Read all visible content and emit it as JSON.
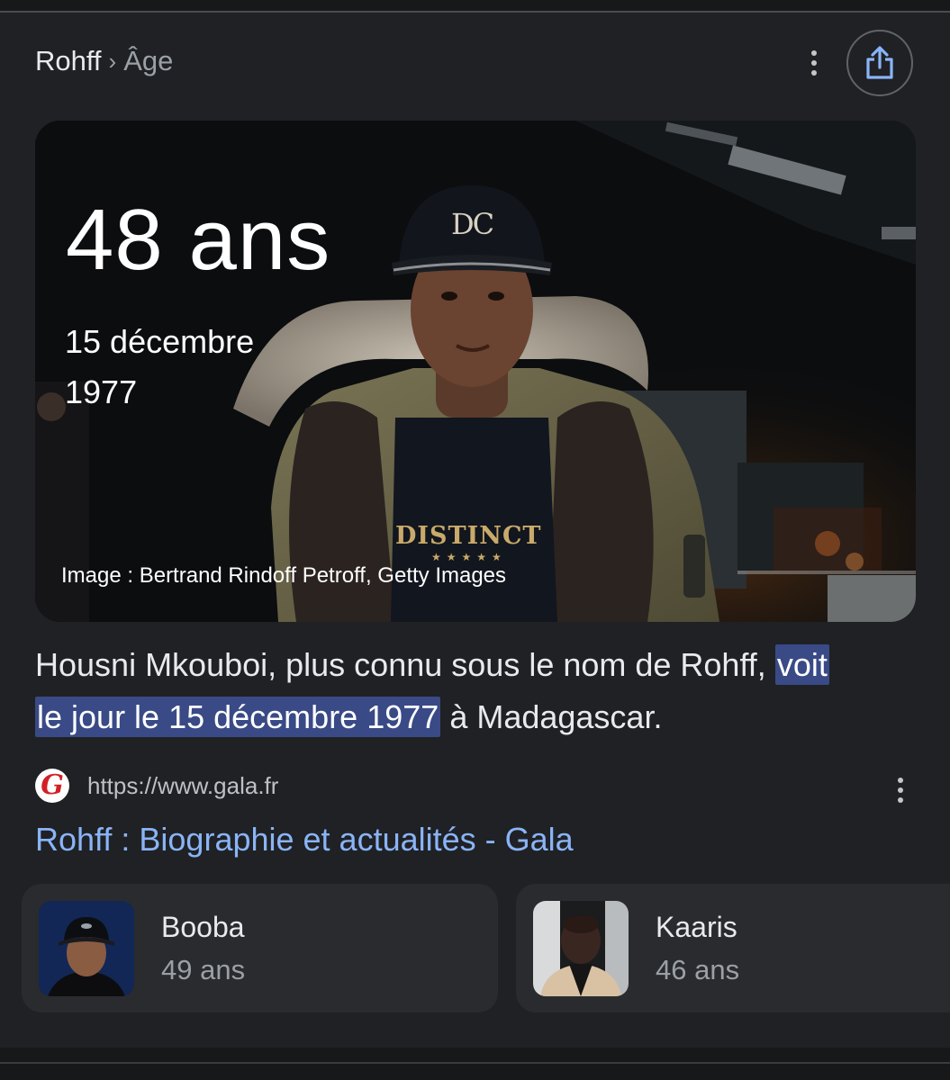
{
  "breadcrumb": {
    "root": "Rohff",
    "separator": "›",
    "leaf": "Âge"
  },
  "hero": {
    "age": "48 ans",
    "birth_date_line1": "15 décembre",
    "birth_date_line2": "1977",
    "image_credit": "Image : Bertrand Rindoff Petroff, Getty Images",
    "cap_logo": "DC",
    "shirt_text": "DISTINCT"
  },
  "snippet": {
    "before": "Housni Mkouboi, plus connu sous le nom de Rohff,",
    "highlight1": "voit",
    "highlight2": "le jour le 15 décembre 1977",
    "after": "à Madagascar."
  },
  "source": {
    "favicon_letter": "G",
    "url": "https://www.gala.fr",
    "title": "Rohff : Biographie et actualités - Gala"
  },
  "related": [
    {
      "name": "Booba",
      "age": "49 ans"
    },
    {
      "name": "Kaaris",
      "age": "46 ans"
    }
  ],
  "icons": {
    "more": "more-vert-icon",
    "share": "share-icon"
  },
  "colors": {
    "background": "#202124",
    "link": "#8ab4f8",
    "highlight": "#394a86",
    "card": "#2a2b2e"
  }
}
